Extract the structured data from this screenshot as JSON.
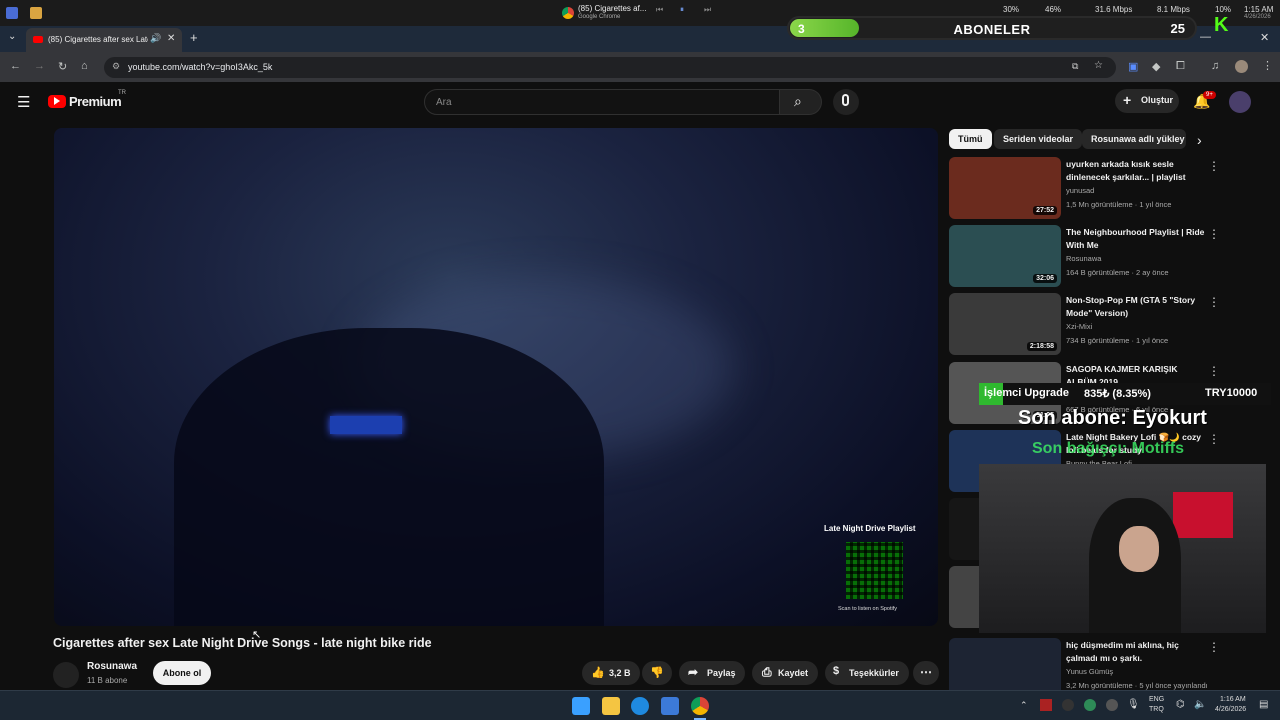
{
  "os_bar": {
    "now_playing_title": "(85) Cigarettes af...",
    "now_playing_app": "Google Chrome",
    "stats": [
      "30%",
      "46%",
      "31.6 Mbps",
      "8.1 Mbps",
      "10%",
      "1:15 AM"
    ],
    "date": "4/26/2026"
  },
  "subscriber_goal": {
    "current": "3",
    "label": "ABONELER",
    "target": "25",
    "progress_fraction": 0.12
  },
  "browser": {
    "tab_title": "(85) Cigarettes after sex Late",
    "url": "youtube.com/watch?v=ghoI3Akc_5k"
  },
  "youtube": {
    "logo_text": "Premium",
    "logo_region": "TR",
    "search_placeholder": "Ara",
    "create_label": "Oluştur",
    "notif_count": "9+"
  },
  "video": {
    "title": "Cigarettes after sex Late Night Drive Songs - late night bike ride",
    "overlay_title": "Late Night Drive Playlist",
    "overlay_caption": "Scan to listen on Spotify",
    "channel": "Rosunawa",
    "channel_subs": "11 B abone",
    "subscribe_label": "Abone ol",
    "like_count": "3,2 B",
    "share_label": "Paylaş",
    "save_label": "Kaydet",
    "thanks_label": "Teşekkürler"
  },
  "chips": [
    "Tümü",
    "Seriden videolar",
    "Rosunawa adlı yükley"
  ],
  "recommendations": [
    {
      "title": "uyurken arkada kısık sesle dinlenecek şarkılar... | playlist",
      "channel": "yunusad",
      "meta": "1,5 Mn görüntüleme · 1 yıl önce",
      "duration": "27:52",
      "color": "#6b2b1e"
    },
    {
      "title": "The Neighbourhood Playlist | Ride With Me",
      "channel": "Rosunawa",
      "meta": "164 B görüntüleme · 2 ay önce",
      "duration": "32:06",
      "color": "#2b4e52"
    },
    {
      "title": "Non-Stop-Pop FM (GTA 5 \"Story Mode\" Version)",
      "channel": "Xzi-Mixi",
      "meta": "734 B görüntüleme · 1 yıl önce",
      "duration": "2:18:58",
      "color": "#3a3a3a"
    },
    {
      "title": "SAGOPA KAJMER KARIŞIK ALBÜM 2019",
      "channel": "",
      "meta": "667 B görüntüleme · 6 yıl önce",
      "duration": "51:05",
      "color": "#555"
    },
    {
      "title": "Late Night Bakery Lofi 🍞🌙 cozy lofi beats for study",
      "channel": "Bunny the Bear Lofi",
      "meta": "",
      "duration": "",
      "color": "#1e3358"
    },
    {
      "title": "",
      "channel": "",
      "meta": "",
      "duration": "",
      "color": "#161616"
    },
    {
      "title": "",
      "channel": "",
      "meta": "",
      "duration": "",
      "color": "#444"
    },
    {
      "title": "hiç düşmedim mi aklına, hiç çalmadı mı o şarkı.",
      "channel": "Yunus Gümüş",
      "meta": "3,2 Mn görüntüleme · 5 yıl önce yayınlandı",
      "duration": "",
      "color": "#1d2433"
    }
  ],
  "stream_overlay": {
    "upgrade_label": "İşlemci Upgrade",
    "upgrade_amount": "835₺ (8.35%)",
    "upgrade_target": "TRY10000",
    "last_sub": "Son abone: Eyokurt",
    "last_tip": "Son bağışçı: Motiffs"
  },
  "taskbar": {
    "lang_top": "ENG",
    "lang_bottom": "TRQ",
    "time": "1:16 AM",
    "date": "4/26/2026"
  }
}
